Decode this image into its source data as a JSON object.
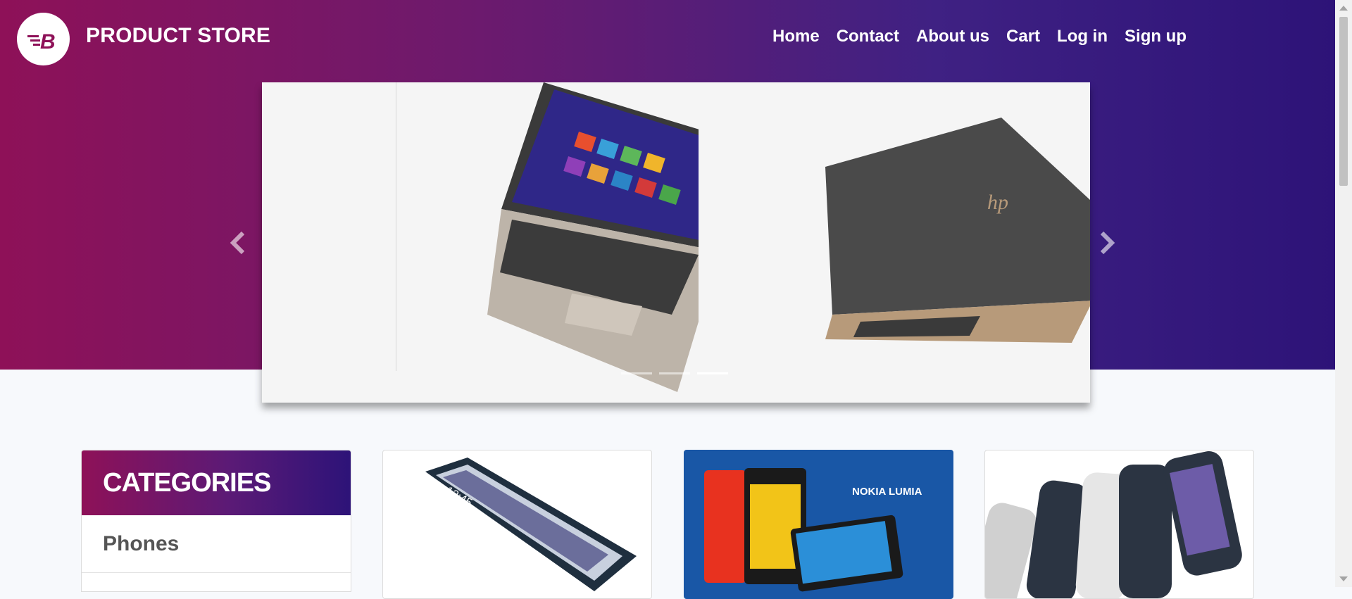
{
  "header": {
    "brand": "PRODUCT STORE",
    "nav": [
      {
        "label": "Home"
      },
      {
        "label": "Contact"
      },
      {
        "label": "About us"
      },
      {
        "label": "Cart"
      },
      {
        "label": "Log in"
      },
      {
        "label": "Sign up"
      }
    ]
  },
  "carousel": {
    "slides_count": 3,
    "active_index": 2
  },
  "categories": {
    "title": "CATEGORIES",
    "items": [
      {
        "label": "Phones"
      }
    ]
  },
  "cards": [
    {
      "image": "samsung-phone"
    },
    {
      "image": "nokia-lumia-phones",
      "overlay_text": "NOKIA LUMIA"
    },
    {
      "image": "nexus-phones"
    }
  ],
  "colors": {
    "gradient_start": "#8e1158",
    "gradient_end": "#2d1378",
    "lumia_blue": "#1957a6"
  }
}
